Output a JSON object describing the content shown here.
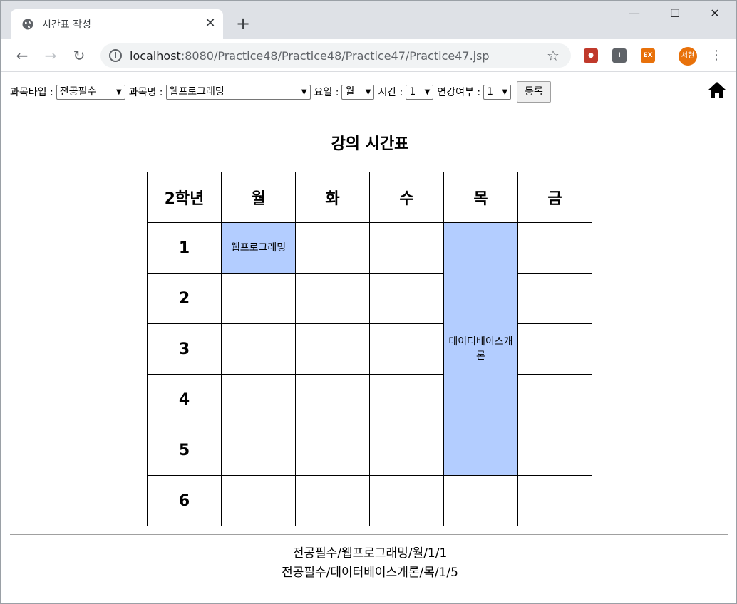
{
  "browser": {
    "tab_title": "시간표 작성",
    "url_host": "localhost",
    "url_rest": ":8080/Practice48/Practice48/Practice47/Practice47.jsp",
    "avatar_text": "서현",
    "ext_label": "EX"
  },
  "form": {
    "type_label": "과목타입 :",
    "type_value": "전공필수",
    "name_label": "과목명 :",
    "name_value": "웹프로그래밍",
    "day_label": "요일 :",
    "day_value": "월",
    "time_label": "시간 :",
    "time_value": "1",
    "consec_label": "연강여부 :",
    "consec_value": "1",
    "submit_label": "등록"
  },
  "timetable": {
    "title": "강의 시간표",
    "corner": "2학년",
    "days": [
      "월",
      "화",
      "수",
      "목",
      "금"
    ],
    "periods": [
      "1",
      "2",
      "3",
      "4",
      "5",
      "6"
    ],
    "courses": {
      "mon1": "웹프로그래밍",
      "thu": "데이터베이스개론"
    }
  },
  "summary": [
    "전공필수/웹프로그래밍/월/1/1",
    "전공필수/데이터베이스개론/목/1/5"
  ],
  "colors": {
    "highlight": "#b3cdff"
  }
}
